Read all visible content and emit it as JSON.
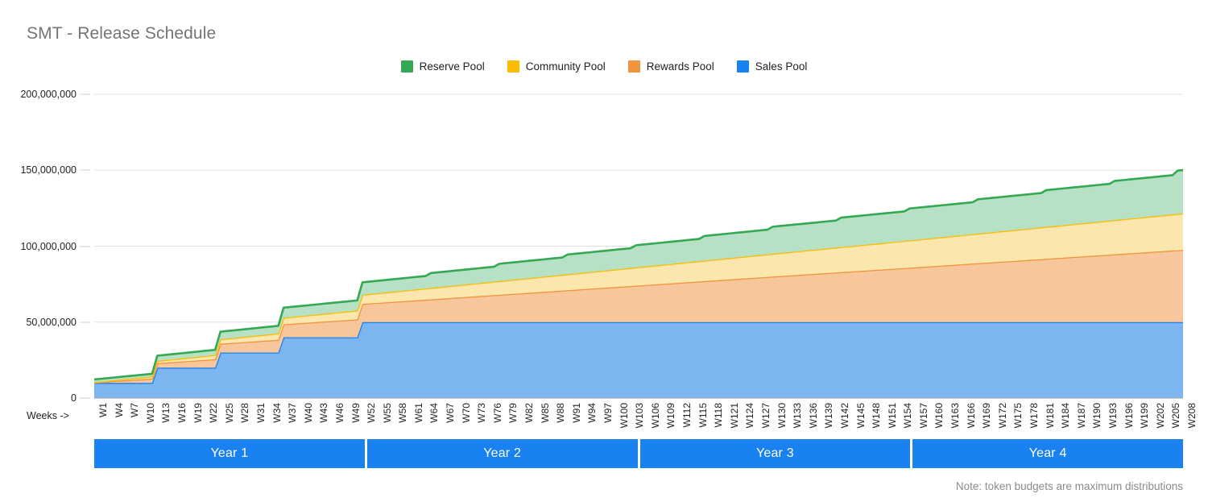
{
  "title": "SMT - Release Schedule",
  "note": "Note: token budgets are maximum distributions",
  "x_axis": {
    "axis_label": "Weeks ->"
  },
  "legend": {
    "items": [
      {
        "label": "Reserve Pool",
        "color": "#34a853"
      },
      {
        "label": "Community Pool",
        "color": "#fbbc04"
      },
      {
        "label": "Rewards Pool",
        "color": "#f0943e"
      },
      {
        "label": "Sales Pool",
        "color": "#1a81f0"
      }
    ]
  },
  "year_bars": [
    {
      "label": "Year 1"
    },
    {
      "label": "Year 2"
    },
    {
      "label": "Year 3"
    },
    {
      "label": "Year 4"
    }
  ],
  "chart_data": {
    "type": "area",
    "stacked": true,
    "title": "SMT - Release Schedule",
    "xlabel": "Weeks ->",
    "ylabel": "",
    "ylim": [
      0,
      200000000
    ],
    "yticks": [
      0,
      50000000,
      100000000,
      150000000,
      200000000
    ],
    "ytick_labels": [
      "0",
      "50,000,000",
      "100,000,000",
      "150,000,000",
      "200,000,000"
    ],
    "grid": true,
    "legend_position": "top-center",
    "annotation": "Note: token budgets are maximum distributions",
    "x_tick_step": 3,
    "x_tick_labels": [
      "W1",
      "W4",
      "W7",
      "W10",
      "W13",
      "W16",
      "W19",
      "W22",
      "W25",
      "W28",
      "W31",
      "W34",
      "W37",
      "W40",
      "W43",
      "W46",
      "W49",
      "W52",
      "W55",
      "W58",
      "W61",
      "W64",
      "W67",
      "W70",
      "W73",
      "W76",
      "W79",
      "W82",
      "W85",
      "W88",
      "W91",
      "W94",
      "W97",
      "W100",
      "W103",
      "W106",
      "W109",
      "W112",
      "W115",
      "W118",
      "W121",
      "W124",
      "W127",
      "W130",
      "W133",
      "W136",
      "W139",
      "W142",
      "W145",
      "W148",
      "W151",
      "W154",
      "W157",
      "W160",
      "W163",
      "W166",
      "W169",
      "W172",
      "W175",
      "W178",
      "W181",
      "W184",
      "W187",
      "W190",
      "W193",
      "W196",
      "W199",
      "W202",
      "W205",
      "W208"
    ],
    "x_range": [
      "W1",
      "W208"
    ],
    "series": [
      {
        "name": "Sales Pool",
        "color": "#1a81f0",
        "fill": "#7cb5f0",
        "note": "Steps up quarterly to 50,000,000 at week 52, then flat.",
        "points": [
          {
            "x": 1,
            "y": 10000000
          },
          {
            "x": 12,
            "y": 10000000
          },
          {
            "x": 13,
            "y": 20000000
          },
          {
            "x": 24,
            "y": 20000000
          },
          {
            "x": 25,
            "y": 30000000
          },
          {
            "x": 36,
            "y": 30000000
          },
          {
            "x": 37,
            "y": 40000000
          },
          {
            "x": 51,
            "y": 40000000
          },
          {
            "x": 52,
            "y": 50000000
          },
          {
            "x": 208,
            "y": 50000000
          }
        ]
      },
      {
        "name": "Rewards Pool",
        "color": "#f0943e",
        "fill": "#f7c79b",
        "note": "Linear weekly release, reaching about 47,600,000 by week 208.",
        "points": [
          {
            "x": 1,
            "y": 300000
          },
          {
            "x": 13,
            "y": 3000000
          },
          {
            "x": 25,
            "y": 5800000
          },
          {
            "x": 37,
            "y": 8600000
          },
          {
            "x": 52,
            "y": 12000000
          },
          {
            "x": 78,
            "y": 18000000
          },
          {
            "x": 104,
            "y": 24000000
          },
          {
            "x": 130,
            "y": 30000000
          },
          {
            "x": 156,
            "y": 35800000
          },
          {
            "x": 182,
            "y": 41700000
          },
          {
            "x": 208,
            "y": 47600000
          }
        ]
      },
      {
        "name": "Community Pool",
        "color": "#fbbc04",
        "fill": "#fbe7ae",
        "note": "Linear weekly release, reaching about 24,000,000 by week 208.",
        "points": [
          {
            "x": 1,
            "y": 150000
          },
          {
            "x": 13,
            "y": 1500000
          },
          {
            "x": 25,
            "y": 2900000
          },
          {
            "x": 37,
            "y": 4300000
          },
          {
            "x": 52,
            "y": 6000000
          },
          {
            "x": 78,
            "y": 9000000
          },
          {
            "x": 104,
            "y": 12000000
          },
          {
            "x": 130,
            "y": 15000000
          },
          {
            "x": 156,
            "y": 18000000
          },
          {
            "x": 182,
            "y": 21000000
          },
          {
            "x": 208,
            "y": 24000000
          }
        ]
      },
      {
        "name": "Reserve Pool",
        "color": "#34a853",
        "fill": "#b7e1c4",
        "note": "Quarterly step releases of about 3,600,000, totalling about 28,500,000 by week 208.",
        "points": [
          {
            "x": 1,
            "y": 1800000
          },
          {
            "x": 12,
            "y": 1800000
          },
          {
            "x": 13,
            "y": 3400000
          },
          {
            "x": 24,
            "y": 3400000
          },
          {
            "x": 25,
            "y": 5000000
          },
          {
            "x": 36,
            "y": 5000000
          },
          {
            "x": 37,
            "y": 6600000
          },
          {
            "x": 51,
            "y": 6600000
          },
          {
            "x": 52,
            "y": 8200000
          },
          {
            "x": 64,
            "y": 8200000
          },
          {
            "x": 65,
            "y": 9800000
          },
          {
            "x": 77,
            "y": 9800000
          },
          {
            "x": 78,
            "y": 11400000
          },
          {
            "x": 90,
            "y": 11400000
          },
          {
            "x": 91,
            "y": 13000000
          },
          {
            "x": 103,
            "y": 13000000
          },
          {
            "x": 104,
            "y": 14600000
          },
          {
            "x": 116,
            "y": 14600000
          },
          {
            "x": 117,
            "y": 16200000
          },
          {
            "x": 129,
            "y": 16200000
          },
          {
            "x": 130,
            "y": 17800000
          },
          {
            "x": 142,
            "y": 17800000
          },
          {
            "x": 143,
            "y": 19400000
          },
          {
            "x": 155,
            "y": 19400000
          },
          {
            "x": 156,
            "y": 21000000
          },
          {
            "x": 168,
            "y": 21000000
          },
          {
            "x": 169,
            "y": 22600000
          },
          {
            "x": 181,
            "y": 22600000
          },
          {
            "x": 182,
            "y": 24200000
          },
          {
            "x": 194,
            "y": 24200000
          },
          {
            "x": 195,
            "y": 25800000
          },
          {
            "x": 206,
            "y": 25800000
          },
          {
            "x": 207,
            "y": 28500000
          },
          {
            "x": 208,
            "y": 28500000
          }
        ]
      }
    ],
    "stacked_totals": [
      {
        "x": 1,
        "total": 12250000
      },
      {
        "x": 13,
        "total": 27900000
      },
      {
        "x": 25,
        "total": 43700000
      },
      {
        "x": 37,
        "total": 59500000
      },
      {
        "x": 52,
        "total": 76200000
      },
      {
        "x": 78,
        "total": 88400000
      },
      {
        "x": 104,
        "total": 100600000
      },
      {
        "x": 130,
        "total": 112800000
      },
      {
        "x": 156,
        "total": 124800000
      },
      {
        "x": 182,
        "total": 136900000
      },
      {
        "x": 208,
        "total": 150100000
      }
    ]
  }
}
